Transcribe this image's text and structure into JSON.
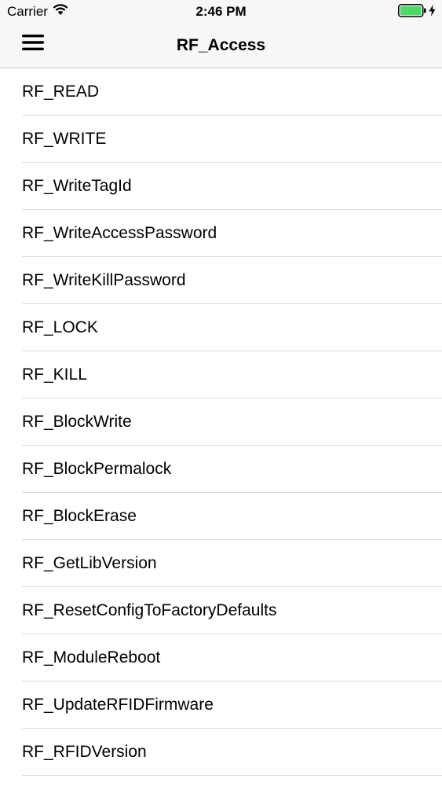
{
  "status_bar": {
    "carrier": "Carrier",
    "time": "2:46 PM",
    "battery_color": "#4cd964"
  },
  "nav_bar": {
    "title": "RF_Access",
    "menu_icon": "hamburger-menu-icon"
  },
  "list": {
    "items": [
      {
        "label": "RF_READ"
      },
      {
        "label": "RF_WRITE"
      },
      {
        "label": "RF_WriteTagId"
      },
      {
        "label": "RF_WriteAccessPassword"
      },
      {
        "label": "RF_WriteKillPassword"
      },
      {
        "label": "RF_LOCK"
      },
      {
        "label": "RF_KILL"
      },
      {
        "label": "RF_BlockWrite"
      },
      {
        "label": "RF_BlockPermalock"
      },
      {
        "label": "RF_BlockErase"
      },
      {
        "label": "RF_GetLibVersion"
      },
      {
        "label": "RF_ResetConfigToFactoryDefaults"
      },
      {
        "label": "RF_ModuleReboot"
      },
      {
        "label": "RF_UpdateRFIDFirmware"
      },
      {
        "label": "RF_RFIDVersion"
      }
    ]
  }
}
